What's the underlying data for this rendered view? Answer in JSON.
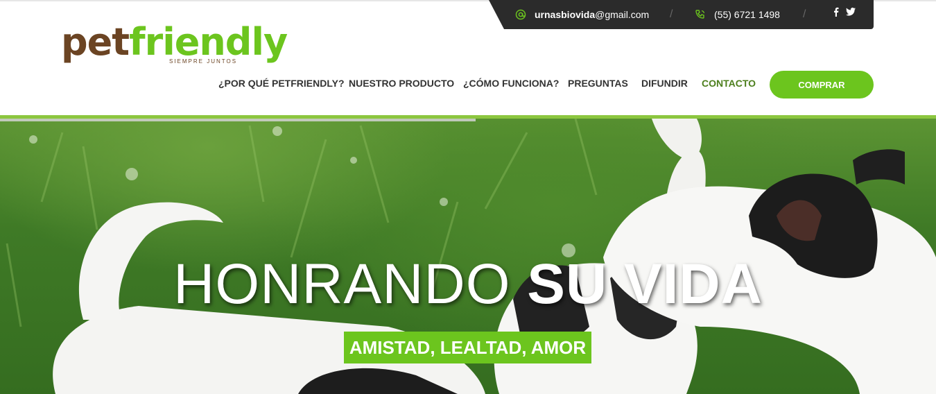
{
  "contact": {
    "email_user": "urnasbiovida",
    "email_domain": "@gmail.com",
    "phone": "(55) 6721 1498",
    "separator": "/"
  },
  "social": {
    "facebook_icon": "facebook-icon",
    "twitter_icon": "twitter-icon"
  },
  "logo": {
    "word1": "pet",
    "word2": "friendly",
    "tagline": "SIEMPRE JUNTOS"
  },
  "nav": {
    "items": [
      {
        "label": "¿POR QUÉ PETFRIENDLY?"
      },
      {
        "label": "NUESTRO PRODUCTO"
      },
      {
        "label": "¿CÓMO FUNCIONA?"
      },
      {
        "label": "PREGUNTAS"
      },
      {
        "label": "DIFUNDIR"
      },
      {
        "label": "CONTACTO"
      }
    ],
    "active": "CONTACTO",
    "buy_label": "COMPRAR"
  },
  "hero": {
    "headline_light": "HONRANDO ",
    "headline_bold": "SU VIDA",
    "tagline": "AMISTAD, LEALTAD, AMOR"
  },
  "colors": {
    "accent": "#6cc51e",
    "brand_brown": "#6b4423",
    "dark_bar": "#2b2b2b"
  }
}
